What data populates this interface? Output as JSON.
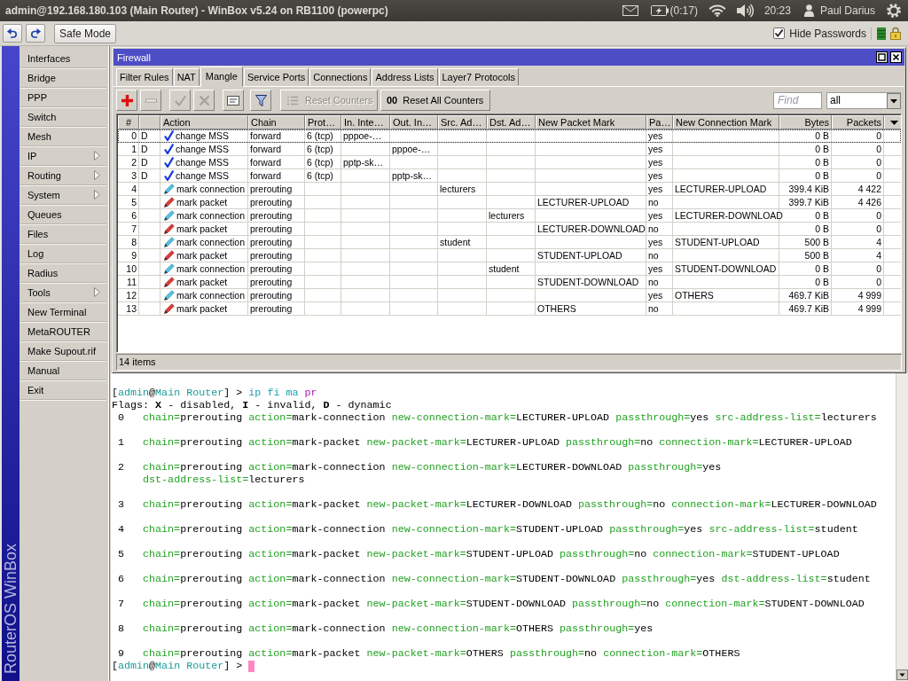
{
  "title_bar": {
    "title": "admin@192.168.180.103 (Main Router) - WinBox v5.24 on RB1100 (powerpc)",
    "battery_time": "(0:17)",
    "clock": "20:23",
    "user": "Paul Darius"
  },
  "toolbar": {
    "safe_mode": "Safe Mode",
    "hide_passwords": {
      "label": "Hide Passwords",
      "checked": true
    }
  },
  "sidebar": {
    "brand": "RouterOS WinBox",
    "items": [
      {
        "label": "Interfaces",
        "submenu": false
      },
      {
        "label": "Bridge",
        "submenu": false
      },
      {
        "label": "PPP",
        "submenu": false
      },
      {
        "label": "Switch",
        "submenu": false
      },
      {
        "label": "Mesh",
        "submenu": false
      },
      {
        "label": "IP",
        "submenu": true
      },
      {
        "label": "Routing",
        "submenu": true
      },
      {
        "label": "System",
        "submenu": true
      },
      {
        "label": "Queues",
        "submenu": false
      },
      {
        "label": "Files",
        "submenu": false
      },
      {
        "label": "Log",
        "submenu": false
      },
      {
        "label": "Radius",
        "submenu": false
      },
      {
        "label": "Tools",
        "submenu": true
      },
      {
        "label": "New Terminal",
        "submenu": false
      },
      {
        "label": "MetaROUTER",
        "submenu": false
      },
      {
        "label": "Make Supout.rif",
        "submenu": false
      },
      {
        "label": "Manual",
        "submenu": false
      },
      {
        "label": "Exit",
        "submenu": false
      }
    ]
  },
  "window": {
    "title": "Firewall",
    "tabs": [
      {
        "label": "Filter Rules",
        "selected": false
      },
      {
        "label": "NAT",
        "selected": false
      },
      {
        "label": "Mangle",
        "selected": true
      },
      {
        "label": "Service Ports",
        "selected": false
      },
      {
        "label": "Connections",
        "selected": false
      },
      {
        "label": "Address Lists",
        "selected": false
      },
      {
        "label": "Layer7 Protocols",
        "selected": false
      }
    ],
    "actions": [
      {
        "kind": "add",
        "disabled": false
      },
      {
        "kind": "remove",
        "disabled": true
      },
      {
        "kind": "enable",
        "disabled": true
      },
      {
        "kind": "disable",
        "disabled": true
      },
      {
        "kind": "comment",
        "disabled": false
      },
      {
        "kind": "filter",
        "disabled": false
      }
    ],
    "reset_counters": {
      "label": "Reset Counters",
      "disabled": true
    },
    "reset_all_counters": {
      "icon": "00",
      "label": "Reset All Counters",
      "disabled": false
    },
    "find": {
      "placeholder": "Find"
    },
    "filter": {
      "value": "all"
    },
    "table": {
      "columns": [
        "#",
        "Action",
        "Chain",
        "Prot…",
        "In. Inte…",
        "Out. In…",
        "Src. Ad…",
        "Dst. Ad…",
        "New Packet Mark",
        "Pa…",
        "New Connection Mark",
        "Bytes",
        "Packets"
      ],
      "rows": [
        {
          "number": "0",
          "column_2": "D",
          "kind": "mss",
          "action": "change MSS",
          "chain": "forward",
          "prot": "6 (tcp)",
          "in_inte": "pppoe-…",
          "pa": "yes",
          "bytes": "0 B",
          "packets": "0",
          "focused": true
        },
        {
          "number": "1",
          "column_2": "D",
          "kind": "mss",
          "action": "change MSS",
          "chain": "forward",
          "prot": "6 (tcp)",
          "out_in": "pppoe-…",
          "pa": "yes",
          "bytes": "0 B",
          "packets": "0",
          "focused": false
        },
        {
          "number": "2",
          "column_2": "D",
          "kind": "mss",
          "action": "change MSS",
          "chain": "forward",
          "prot": "6 (tcp)",
          "in_inte": "pptp-sk…",
          "pa": "yes",
          "bytes": "0 B",
          "packets": "0",
          "focused": false
        },
        {
          "number": "3",
          "column_2": "D",
          "kind": "mss",
          "action": "change MSS",
          "chain": "forward",
          "prot": "6 (tcp)",
          "out_in": "pptp-sk…",
          "pa": "yes",
          "bytes": "0 B",
          "packets": "0",
          "focused": false
        },
        {
          "number": "4",
          "kind": "connection",
          "action": "mark connection",
          "chain": "prerouting",
          "src_ad": "lecturers",
          "pa": "yes",
          "new_connection_mark": "LECTURER-UPLOAD",
          "bytes": "399.4 KiB",
          "packets": "4 422",
          "focused": false
        },
        {
          "number": "5",
          "kind": "packet",
          "action": "mark packet",
          "chain": "prerouting",
          "new_packet_mark": "LECTURER-UPLOAD",
          "pa": "no",
          "bytes": "399.7 KiB",
          "packets": "4 426",
          "focused": false
        },
        {
          "number": "6",
          "kind": "connection",
          "action": "mark connection",
          "chain": "prerouting",
          "dst_ad": "lecturers",
          "pa": "yes",
          "new_connection_mark": "LECTURER-DOWNLOAD",
          "bytes": "0 B",
          "packets": "0",
          "focused": false
        },
        {
          "number": "7",
          "kind": "packet",
          "action": "mark packet",
          "chain": "prerouting",
          "new_packet_mark": "LECTURER-DOWNLOAD",
          "pa": "no",
          "bytes": "0 B",
          "packets": "0",
          "focused": false
        },
        {
          "number": "8",
          "kind": "connection",
          "action": "mark connection",
          "chain": "prerouting",
          "src_ad": "student",
          "pa": "yes",
          "new_connection_mark": "STUDENT-UPLOAD",
          "bytes": "500 B",
          "packets": "4",
          "focused": false
        },
        {
          "number": "9",
          "kind": "packet",
          "action": "mark packet",
          "chain": "prerouting",
          "new_packet_mark": "STUDENT-UPLOAD",
          "pa": "no",
          "bytes": "500 B",
          "packets": "4",
          "focused": false
        },
        {
          "number": "10",
          "kind": "connection",
          "action": "mark connection",
          "chain": "prerouting",
          "dst_ad": "student",
          "pa": "yes",
          "new_connection_mark": "STUDENT-DOWNLOAD",
          "bytes": "0 B",
          "packets": "0",
          "focused": false
        },
        {
          "number": "11",
          "kind": "packet",
          "action": "mark packet",
          "chain": "prerouting",
          "new_packet_mark": "STUDENT-DOWNLOAD",
          "pa": "no",
          "bytes": "0 B",
          "packets": "0",
          "focused": false
        },
        {
          "number": "12",
          "kind": "connection",
          "action": "mark connection",
          "chain": "prerouting",
          "pa": "yes",
          "new_connection_mark": "OTHERS",
          "bytes": "469.7 KiB",
          "packets": "4 999",
          "focused": false
        },
        {
          "number": "13",
          "kind": "packet",
          "action": "mark packet",
          "chain": "prerouting",
          "new_packet_mark": "OTHERS",
          "pa": "no",
          "bytes": "469.7 KiB",
          "packets": "4 999",
          "focused": false
        }
      ]
    },
    "status": "14 items"
  },
  "terminal": {
    "command_line": {
      "prompt": [
        {
          "kind": "bracket",
          "text": "["
        },
        {
          "kind": "name",
          "text": "admin"
        },
        {
          "kind": "bracket",
          "text": "@"
        },
        {
          "kind": "name",
          "text": "Main Router"
        },
        {
          "kind": "bracket",
          "text": "] >"
        }
      ],
      "words": [
        {
          "kind": "menu",
          "text": "ip"
        },
        {
          "kind": "menu",
          "text": "fi"
        },
        {
          "kind": "menu",
          "text": "ma"
        },
        {
          "kind": "command",
          "text": "pr"
        }
      ]
    },
    "flags": "Flags: **X** - disabled, **I** - invalid, **D** - dynamic",
    "entries": [
      {
        "number": "0",
        "lines": [
          [
            [
              "chain=",
              "prerouting"
            ],
            [
              "action=",
              "mark-connection"
            ],
            [
              "new-connection-mark=",
              "LECTURER-UPLOAD"
            ],
            [
              "passthrough=",
              "yes"
            ],
            [
              "src-address-list=",
              "lecturers"
            ]
          ]
        ]
      },
      {
        "number": "1",
        "lines": [
          [
            [
              "chain=",
              "prerouting"
            ],
            [
              "action=",
              "mark-packet"
            ],
            [
              "new-packet-mark=",
              "LECTURER-UPLOAD"
            ],
            [
              "passthrough=",
              "no"
            ],
            [
              "connection-mark=",
              "LECTURER-UPLOAD"
            ]
          ]
        ]
      },
      {
        "number": "2",
        "lines": [
          [
            [
              "chain=",
              "prerouting"
            ],
            [
              "action=",
              "mark-connection"
            ],
            [
              "new-connection-mark=",
              "LECTURER-DOWNLOAD"
            ],
            [
              "passthrough=",
              "yes"
            ]
          ],
          [
            [
              "dst-address-list=",
              "lecturers"
            ]
          ]
        ]
      },
      {
        "number": "3",
        "lines": [
          [
            [
              "chain=",
              "prerouting"
            ],
            [
              "action=",
              "mark-packet"
            ],
            [
              "new-packet-mark=",
              "LECTURER-DOWNLOAD"
            ],
            [
              "passthrough=",
              "no"
            ],
            [
              "connection-mark=",
              "LECTURER-DOWNLOAD"
            ]
          ]
        ]
      },
      {
        "number": "4",
        "lines": [
          [
            [
              "chain=",
              "prerouting"
            ],
            [
              "action=",
              "mark-connection"
            ],
            [
              "new-connection-mark=",
              "STUDENT-UPLOAD"
            ],
            [
              "passthrough=",
              "yes"
            ],
            [
              "src-address-list=",
              "student"
            ]
          ]
        ]
      },
      {
        "number": "5",
        "lines": [
          [
            [
              "chain=",
              "prerouting"
            ],
            [
              "action=",
              "mark-packet"
            ],
            [
              "new-packet-mark=",
              "STUDENT-UPLOAD"
            ],
            [
              "passthrough=",
              "no"
            ],
            [
              "connection-mark=",
              "STUDENT-UPLOAD"
            ]
          ]
        ]
      },
      {
        "number": "6",
        "lines": [
          [
            [
              "chain=",
              "prerouting"
            ],
            [
              "action=",
              "mark-connection"
            ],
            [
              "new-connection-mark=",
              "STUDENT-DOWNLOAD"
            ],
            [
              "passthrough=",
              "yes"
            ],
            [
              "dst-address-list=",
              "student"
            ]
          ]
        ]
      },
      {
        "number": "7",
        "lines": [
          [
            [
              "chain=",
              "prerouting"
            ],
            [
              "action=",
              "mark-packet"
            ],
            [
              "new-packet-mark=",
              "STUDENT-DOWNLOAD"
            ],
            [
              "passthrough=",
              "no"
            ],
            [
              "connection-mark=",
              "STUDENT-DOWNLOAD"
            ]
          ]
        ]
      },
      {
        "number": "8",
        "lines": [
          [
            [
              "chain=",
              "prerouting"
            ],
            [
              "action=",
              "mark-connection"
            ],
            [
              "new-connection-mark=",
              "OTHERS"
            ],
            [
              "passthrough=",
              "yes"
            ]
          ]
        ]
      },
      {
        "number": "9",
        "lines": [
          [
            [
              "chain=",
              "prerouting"
            ],
            [
              "action=",
              "mark-packet"
            ],
            [
              "new-packet-mark=",
              "OTHERS"
            ],
            [
              "passthrough=",
              "no"
            ],
            [
              "connection-mark=",
              "OTHERS"
            ]
          ]
        ]
      }
    ],
    "input_line": {
      "prompt": [
        {
          "kind": "bracket",
          "text": "["
        },
        {
          "kind": "name",
          "text": "admin"
        },
        {
          "kind": "bracket",
          "text": "@"
        },
        {
          "kind": "name",
          "text": "Main Router"
        },
        {
          "kind": "bracket",
          "text": "] >"
        }
      ],
      "cursor": true
    }
  }
}
